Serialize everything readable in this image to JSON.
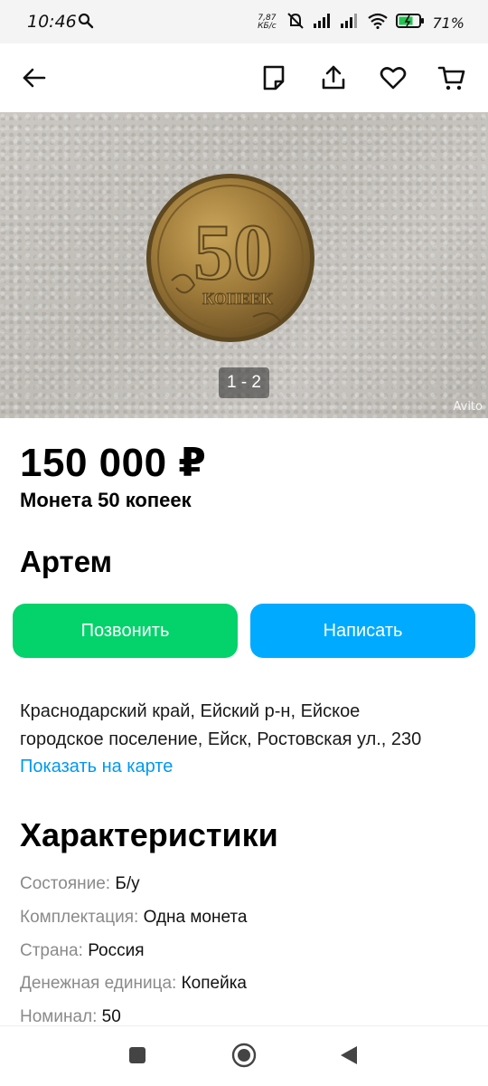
{
  "status_bar": {
    "time": "10:46",
    "net_speed_value": "7,87",
    "net_speed_unit": "КБ/с",
    "battery": "71%"
  },
  "app_bar": {
    "icons": [
      "back-arrow-icon",
      "note-icon",
      "share-icon",
      "heart-icon",
      "cart-icon"
    ]
  },
  "gallery": {
    "counter": "1 - 2",
    "watermark": "Avito",
    "coin": {
      "value": "50",
      "word": "КОПЕЕК"
    }
  },
  "listing": {
    "price": "150 000 ₽",
    "title": "Монета 50 копеек",
    "seller": "Артем"
  },
  "actions": {
    "call_label": "Позвонить",
    "write_label": "Написать",
    "call_color": "#04d26a",
    "write_color": "#00aaff"
  },
  "location": {
    "address_line1": "Краснодарский край, Ейский р-н, Ейское",
    "address_line2": "городское поселение, Ейск, Ростовская ул., 230",
    "map_link": "Показать на карте"
  },
  "specs": {
    "title": "Характеристики",
    "items": [
      {
        "key": "Состояние:",
        "value": "Б/у"
      },
      {
        "key": "Комплектация:",
        "value": "Одна монета"
      },
      {
        "key": "Страна:",
        "value": "Россия"
      },
      {
        "key": "Денежная единица:",
        "value": "Копейка"
      },
      {
        "key": "Номинал:",
        "value": "50"
      }
    ]
  }
}
